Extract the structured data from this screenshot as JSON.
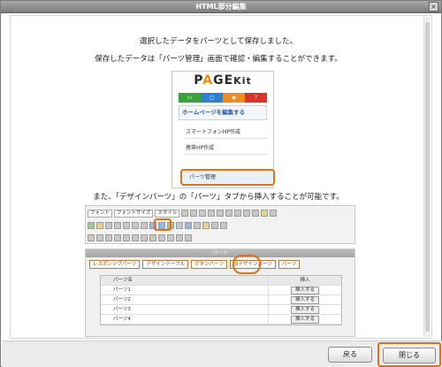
{
  "window": {
    "title": "HTML部分編集",
    "close_glyph": "×"
  },
  "content": {
    "line1": "選択したデータをパーツとして保存しました。",
    "line2": "保存したデータは「パーツ管理」画面で確認・編集することができます。",
    "line3": "また、「デザインパーツ」の「パーツ」タブから挿入することが可能です。"
  },
  "pagekit": {
    "logo_p": "P",
    "logo_a": "A",
    "logo_g": "G",
    "logo_e": "E",
    "logo_kit": "Kit",
    "bar_icons": [
      "▭",
      "▢",
      "◆",
      "?"
    ],
    "home_label": "ホームページを編集する",
    "items": [
      "スマートフォンHP作成",
      "携帯HP作成"
    ],
    "parts_label": "パーツ管理"
  },
  "toolbar": {
    "font_label": "フォント",
    "size_label": "フォントサイズ",
    "style_label": "スタイル"
  },
  "parts_panel": {
    "header": "パーツ",
    "tabs": [
      "レスポンシブパーツ",
      "デザインテーブル",
      "ボタンパーツ",
      "旧デザインパーツ",
      "パーツ"
    ],
    "col_name": "パーツ名",
    "col_insert": "挿入",
    "rows": [
      {
        "name": "パーツ1",
        "btn": "挿入する"
      },
      {
        "name": "パーツ2",
        "btn": "挿入する"
      },
      {
        "name": "パーツ3",
        "btn": "挿入する"
      },
      {
        "name": "パーツ4",
        "btn": "挿入する"
      }
    ]
  },
  "footer": {
    "back_label": "戻る",
    "close_label": "閉じる"
  },
  "colors": {
    "accent": "#e0731a",
    "green": "#3ba13b",
    "blue": "#2f7fd1",
    "orange": "#f08a24",
    "red": "#d9342b"
  }
}
